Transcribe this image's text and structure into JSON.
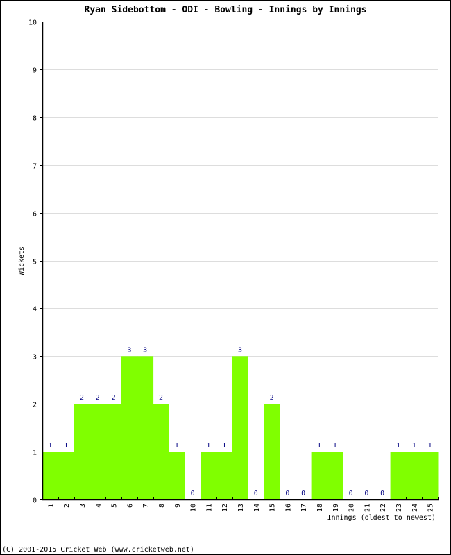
{
  "chart_data": {
    "type": "bar",
    "title": "Ryan Sidebottom - ODI - Bowling - Innings by Innings",
    "xlabel": "Innings (oldest to newest)",
    "ylabel": "Wickets",
    "ylim": [
      0,
      10
    ],
    "yticks": [
      "0",
      "1",
      "2",
      "3",
      "4",
      "5",
      "6",
      "7",
      "8",
      "9",
      "10"
    ],
    "grid": true,
    "categories": [
      "1",
      "2",
      "3",
      "4",
      "5",
      "6",
      "7",
      "8",
      "9",
      "10",
      "11",
      "12",
      "13",
      "14",
      "15",
      "16",
      "17",
      "18",
      "19",
      "20",
      "21",
      "22",
      "23",
      "24",
      "25"
    ],
    "values": [
      1,
      1,
      2,
      2,
      2,
      3,
      3,
      2,
      1,
      0,
      1,
      1,
      3,
      0,
      2,
      0,
      0,
      1,
      1,
      0,
      0,
      0,
      1,
      1,
      1
    ],
    "colors": {
      "bar": "#80ff00",
      "label": "#000080",
      "grid": "#dddddd",
      "axis": "#000000"
    }
  },
  "footer": "(C) 2001-2015 Cricket Web (www.cricketweb.net)"
}
